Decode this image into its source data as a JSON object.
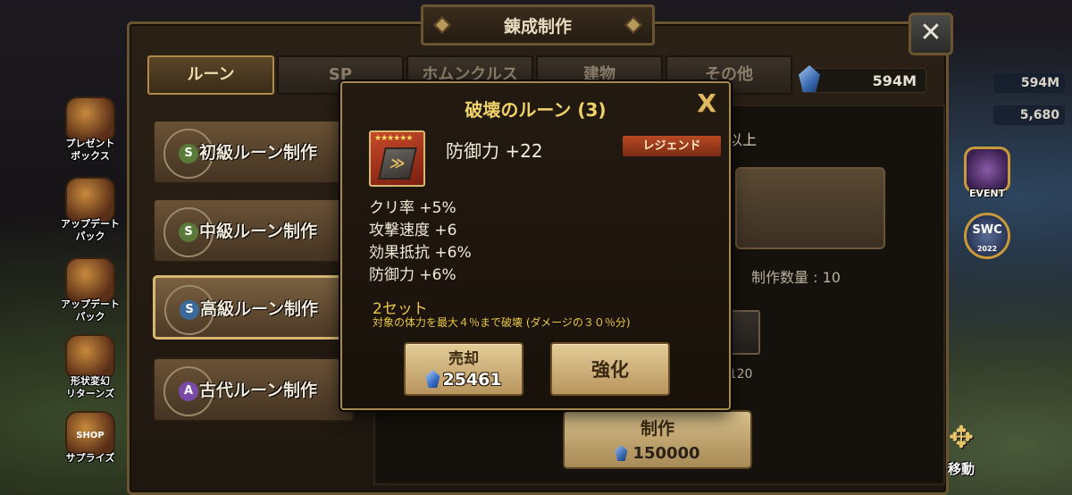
{
  "window": {
    "title": "錬成制作"
  },
  "tabs": [
    {
      "label": "ルーン",
      "active": true
    },
    {
      "label": "SP",
      "active": false
    },
    {
      "label": "ホムンクルス",
      "active": false
    },
    {
      "label": "建物",
      "active": false
    },
    {
      "label": "その他",
      "active": false
    }
  ],
  "currency": {
    "amount": "594M",
    "icon": "crystal-icon"
  },
  "left_menu": [
    {
      "label": "プレゼント\nボックス",
      "icon": "gift-box-icon"
    },
    {
      "label": "アップデート\nパック",
      "icon": "update-pack-icon"
    },
    {
      "label": "アップデート\nパック",
      "icon": "update-pack-icon"
    },
    {
      "label": "形状変幻\nリターンズ",
      "icon": "transform-icon"
    },
    {
      "label": "サプライズ",
      "icon": "shop-icon",
      "badge": "SHOP"
    }
  ],
  "right_menu": {
    "stats": [
      "594M",
      "5,680"
    ],
    "event_label": "EVENT",
    "swc_label": "SWC",
    "swc_year": "2022",
    "move_label": "移動"
  },
  "craft_buttons": [
    {
      "label": "初級ルーン制作",
      "core": "S",
      "active": false
    },
    {
      "label": "中級ルーン制作",
      "core": "S",
      "active": false
    },
    {
      "label": "高級ルーン制作",
      "core": "S",
      "active": true
    },
    {
      "label": "古代ルーン制作",
      "core": "A",
      "active": false
    }
  ],
  "content": {
    "note": "以上",
    "quantity": "制作数量 : 10",
    "count": "/120",
    "make_label": "制作",
    "make_cost": "150000"
  },
  "modal": {
    "title": "破壊のルーン (3)",
    "close": "X",
    "stars": "★★★★★★",
    "main_stat": "防御力 +22",
    "grade": "レジェンド",
    "sub_stats": [
      "クリ率 +5%",
      "攻撃速度 +6",
      "効果抵抗 +6%",
      "防御力 +6%"
    ],
    "set_name": "2セット",
    "set_desc": "対象の体力を最大４％まで破壊 (ダメージの３０％分)",
    "sell_label": "売却",
    "sell_price": "25461",
    "power_label": "強化"
  },
  "colors": {
    "accent_gold": "#e8c848",
    "legend_badge": "#b84a24",
    "frame": "#a88850"
  }
}
